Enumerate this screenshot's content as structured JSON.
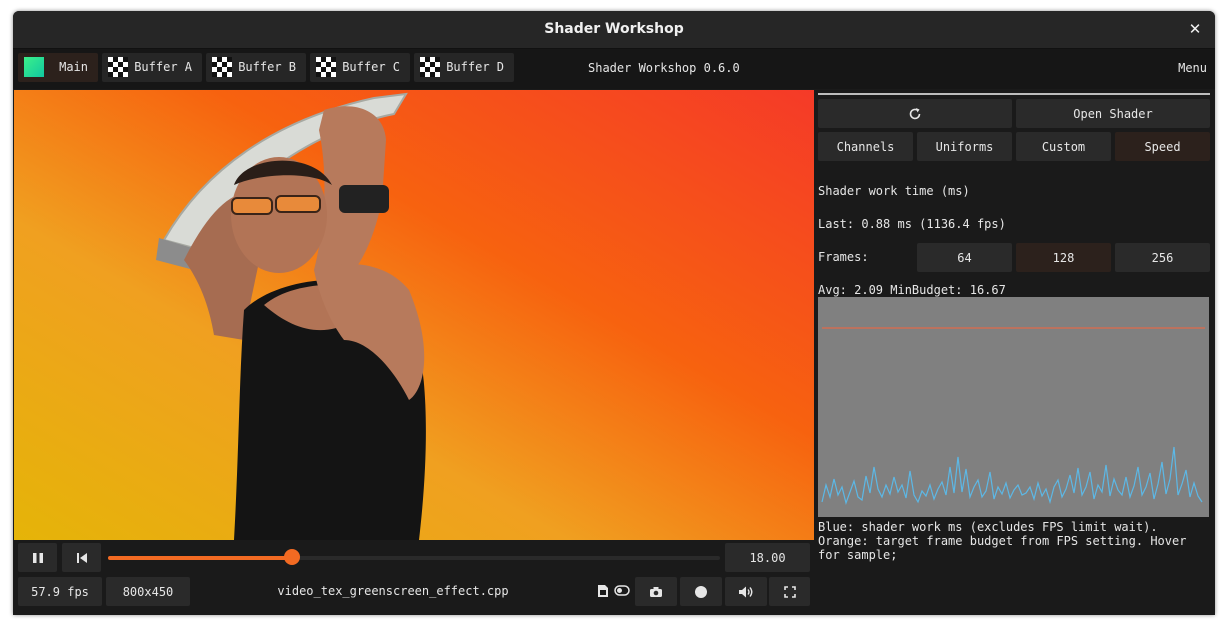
{
  "window": {
    "title": "Shader Workshop"
  },
  "topbar": {
    "tabs": [
      {
        "label": "Main"
      },
      {
        "label": "Buffer A"
      },
      {
        "label": "Buffer B"
      },
      {
        "label": "Buffer C"
      },
      {
        "label": "Buffer D"
      }
    ],
    "version": "Shader Workshop 0.6.0",
    "menu_label": "Menu"
  },
  "playback": {
    "time": "18.00",
    "progress_fraction": 0.3,
    "fps": "57.9 fps",
    "resolution": "800x450",
    "filename": "video_tex_greenscreen_effect.cpp"
  },
  "panel": {
    "open_shader_label": "Open Shader",
    "tabs": [
      {
        "label": "Channels"
      },
      {
        "label": "Uniforms"
      },
      {
        "label": "Custom"
      },
      {
        "label": "Speed"
      }
    ],
    "section_title": "Shader work time (ms)",
    "last_line": "Last: 0.88 ms  (1136.4 fps)",
    "frames_label": "Frames:",
    "frame_options": [
      "64",
      "128",
      "256"
    ],
    "avg_line": "Avg: 2.09  MinBudget: 16.67",
    "caption": "Blue: shader work ms (excludes FPS limit wait). Orange: target frame budget from FPS setting. Hover for sample;"
  },
  "colors": {
    "accent": "#f26a22",
    "work_line": "#5cb8e6",
    "budget_line": "#e06a4a",
    "graph_bg": "#808080"
  },
  "icons": {
    "reload": "reload-icon",
    "pause": "pause-icon",
    "restart": "skip-back-icon",
    "file": "file-icon",
    "toggle": "toggle-icon",
    "screenshot": "camera-icon",
    "record": "record-icon",
    "volume": "volume-icon",
    "fullscreen": "fullscreen-icon"
  }
}
